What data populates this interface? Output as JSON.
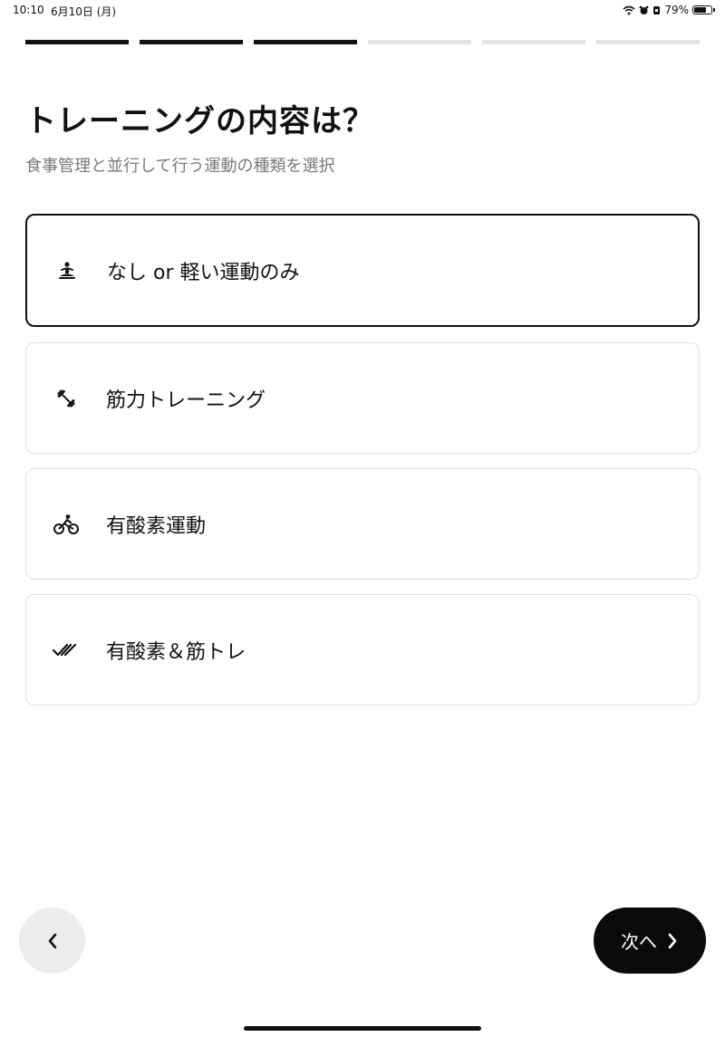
{
  "status_bar": {
    "time": "10:10",
    "date": "6月10日 (月)",
    "battery": "79%",
    "battery_level": 0.79
  },
  "progress": {
    "total_steps": 6,
    "completed_steps": 3
  },
  "header": {
    "title": "トレーニングの内容は？",
    "subtitle": "食事管理と並行して行う運動の種類を選択"
  },
  "options": [
    {
      "label": "なし or 軽い運動のみ",
      "icon": "meditation-icon",
      "selected": true
    },
    {
      "label": "筋力トレーニング",
      "icon": "dumbbell-icon",
      "selected": false
    },
    {
      "label": "有酸素運動",
      "icon": "cycling-icon",
      "selected": false
    },
    {
      "label": "有酸素＆筋トレ",
      "icon": "double-check-icon",
      "selected": false
    }
  ],
  "nav": {
    "next_label": "次へ"
  },
  "colors": {
    "accent": "#111111",
    "muted_text": "#7a7a7a",
    "border": "#e0e0e0",
    "progress_inactive": "#e4e4e4"
  }
}
